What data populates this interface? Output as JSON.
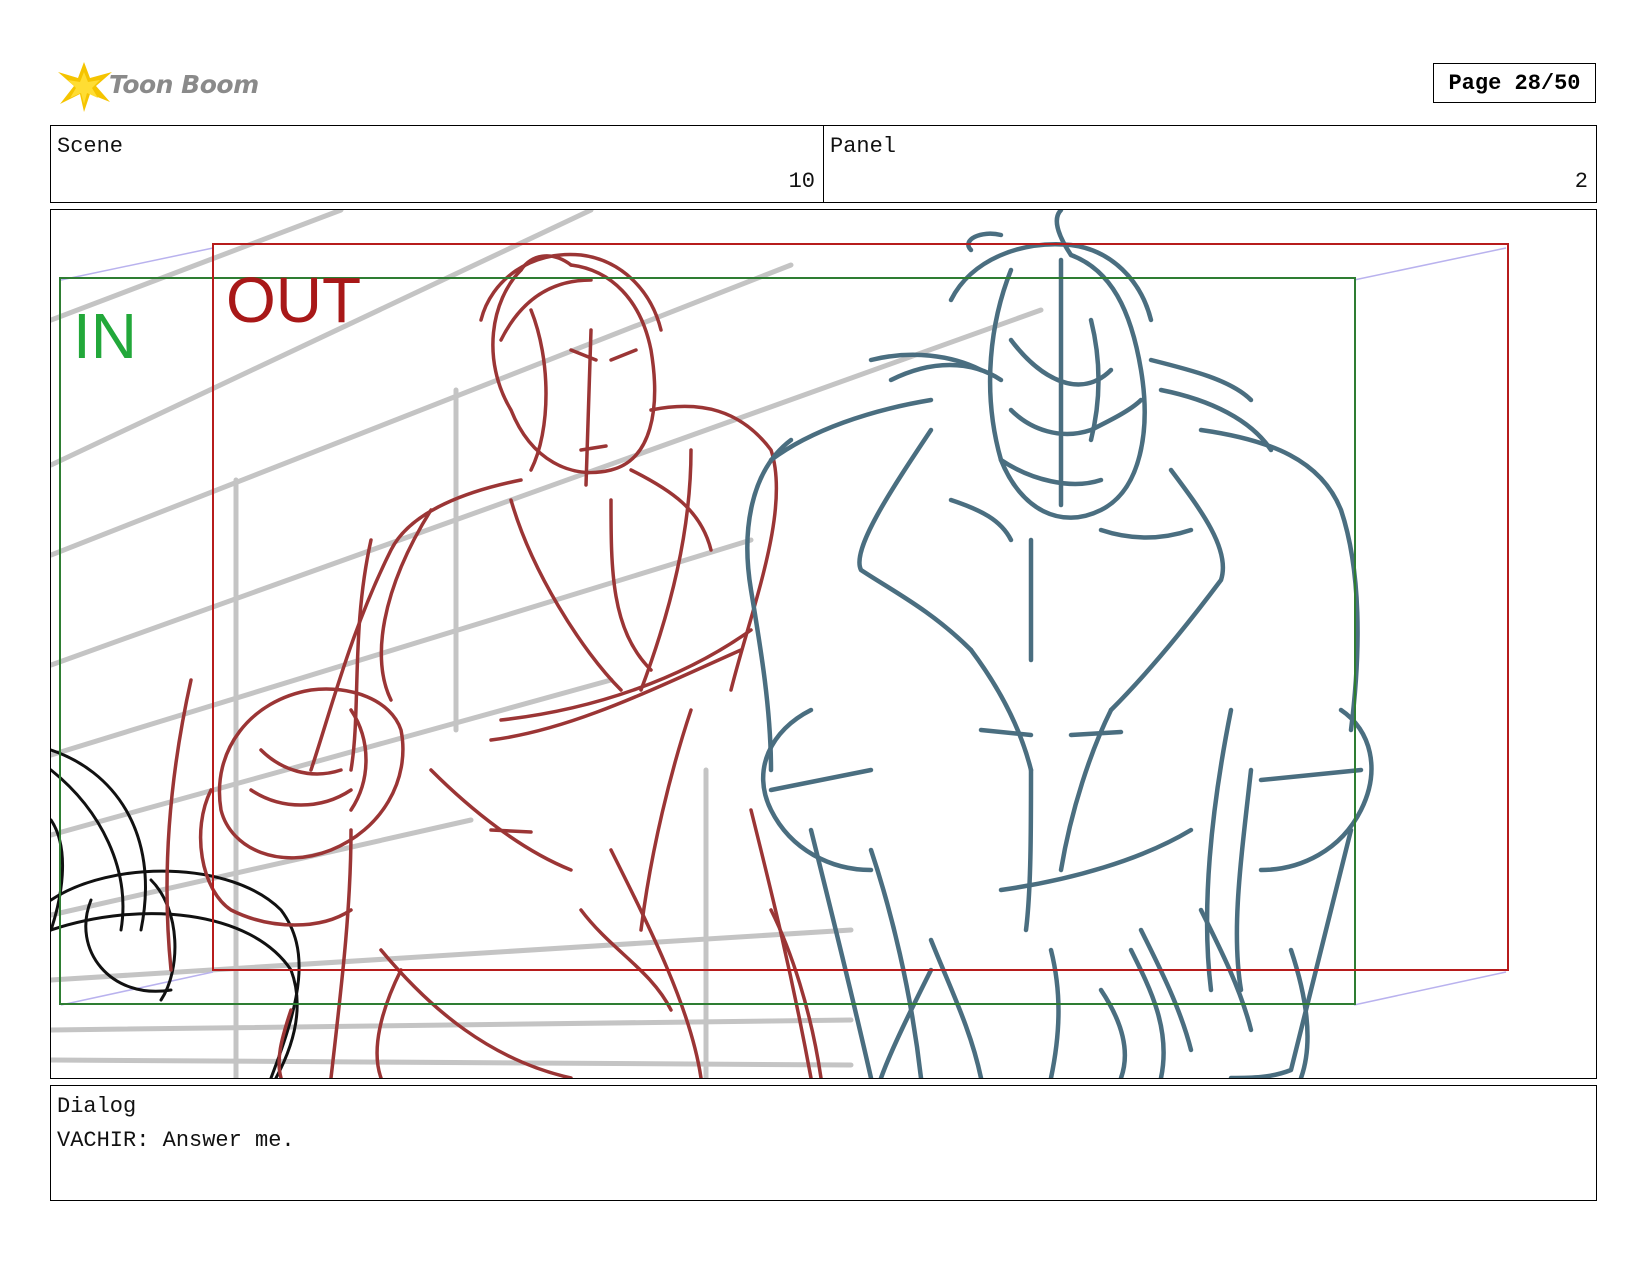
{
  "header": {
    "logo_text": "Toon Boom",
    "page_label": "Page 28/50"
  },
  "info": {
    "scene_label": "Scene",
    "scene_value": "10",
    "panel_label": "Panel",
    "panel_value": "2"
  },
  "panel": {
    "in_label": "IN",
    "out_label": "OUT",
    "colors": {
      "in_frame": "#2e7d32",
      "in_text": "#22a83a",
      "out_frame": "#b71c1c",
      "out_text": "#a81818",
      "character_left": "#9b3535",
      "character_right": "#4a6e80",
      "background": "#c4c4c4",
      "foreground": "#111111",
      "camera_guides": "#b9b2ee"
    }
  },
  "dialog": {
    "label": "Dialog",
    "text": "VACHIR: Answer me."
  }
}
